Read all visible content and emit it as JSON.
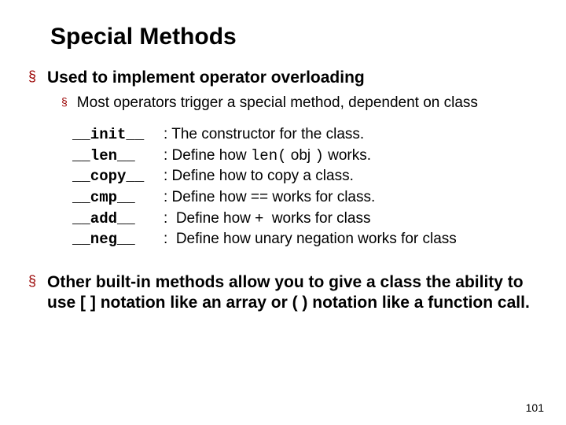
{
  "title": "Special Methods",
  "bullets": {
    "b1": "Used to implement operator overloading",
    "b1_1": "Most operators trigger a special method, dependent on class",
    "b2": "Other built-in methods allow you to give a class the ability to use [ ] notation like an array or ( ) notation like a function call."
  },
  "methods": [
    {
      "name": "__init__",
      "colon": ":",
      "desc_pre": " The constructor for the class."
    },
    {
      "name": "__len__ ",
      "colon": ":",
      "desc_pre": " Define how ",
      "code": "len(",
      "mid": " obj ",
      "code2": ")",
      "desc_post": " works."
    },
    {
      "name": "__copy__",
      "colon": ":",
      "desc_pre": " Define how to copy a class."
    },
    {
      "name": "__cmp__ ",
      "colon": ":",
      "desc_pre": " Define how == works for class."
    },
    {
      "name": "__add__ ",
      "colon": ":",
      "desc_pre": "  Define how +  works for class"
    },
    {
      "name": "__neg__ ",
      "colon": ":",
      "desc_pre": "  Define how unary negation works for class"
    }
  ],
  "page_number": "101"
}
